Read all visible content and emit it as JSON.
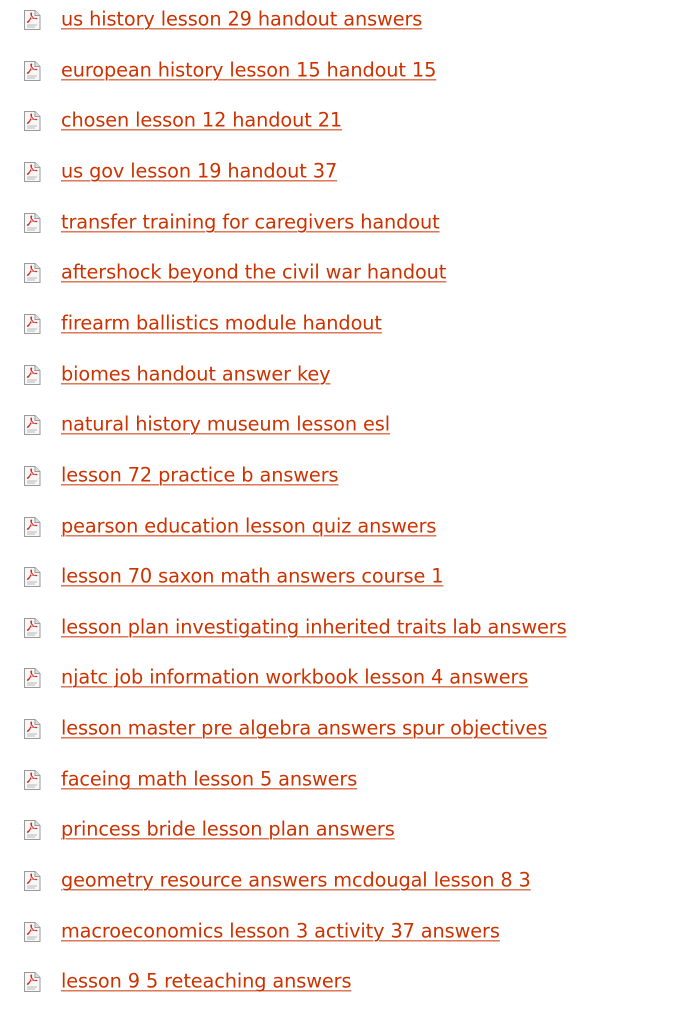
{
  "colors": {
    "link": "#cc3300",
    "icon_red": "#d42a1e",
    "background": "#ffffff"
  },
  "icon": "pdf-file-icon",
  "links": [
    {
      "label": "us history lesson 29 handout answers"
    },
    {
      "label": "european history lesson 15 handout 15"
    },
    {
      "label": "chosen lesson 12 handout 21"
    },
    {
      "label": "us gov lesson 19 handout 37"
    },
    {
      "label": "transfer training for caregivers handout"
    },
    {
      "label": "aftershock beyond the civil war handout"
    },
    {
      "label": "firearm ballistics module handout"
    },
    {
      "label": "biomes handout answer key"
    },
    {
      "label": "natural history museum lesson esl"
    },
    {
      "label": "lesson 72 practice b answers"
    },
    {
      "label": "pearson education lesson quiz answers"
    },
    {
      "label": "lesson 70 saxon math answers course 1"
    },
    {
      "label": "lesson plan investigating inherited traits lab answers"
    },
    {
      "label": "njatc job information workbook lesson 4 answers"
    },
    {
      "label": "lesson master pre algebra answers spur objectives"
    },
    {
      "label": "faceing math lesson 5 answers"
    },
    {
      "label": "princess bride lesson plan answers"
    },
    {
      "label": "geometry resource answers mcdougal lesson 8 3"
    },
    {
      "label": "macroeconomics lesson 3 activity 37 answers"
    },
    {
      "label": "lesson 9 5 reteaching answers"
    }
  ]
}
